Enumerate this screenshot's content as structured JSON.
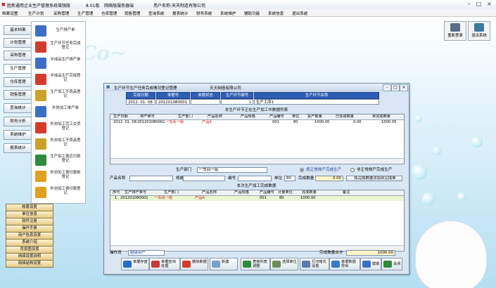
{
  "app": {
    "title": "胜新通用企业生产管理系统增强版",
    "version": "8.01版",
    "network": "网络版服务器端",
    "user": "用户名称:天天制造有限公司"
  },
  "menu": [
    "档案设置",
    "生产计划",
    "采购管理",
    "生产管理",
    "仓库管理",
    "销售管理",
    "查询系统",
    "报表统计",
    "财务系统",
    "系统维护",
    "辅助功能",
    "系统信息",
    "退出系统"
  ],
  "top_right_buttons": [
    {
      "label": "重新登录",
      "icon": "user-login-icon"
    },
    {
      "label": "退出系统",
      "icon": "exit-icon"
    }
  ],
  "left_tabs": [
    "基本档案",
    "计划管理",
    "采购管理",
    "生产管理",
    "仓库管理",
    "销售管理",
    "查询统计",
    "财务分析",
    "系统维护",
    "报表统计"
  ],
  "active_tab": "生产管理",
  "modules": [
    {
      "label": "生产排产单",
      "icon": "schedule-icon",
      "color": "#3b6fc4"
    },
    {
      "label": "生产环节任务完成登记",
      "icon": "arrow-up-icon",
      "color": "#d23c2a"
    },
    {
      "label": "半成品生产排产单",
      "icon": "schedule-icon",
      "color": "#3b6fc4"
    },
    {
      "label": "半成品生产完成登记",
      "icon": "arrow-up-icon",
      "color": "#d23c2a"
    },
    {
      "label": "生产加工不良品登记",
      "icon": "warning-icon",
      "color": "#c9a227"
    },
    {
      "label": "外协加工排产单",
      "icon": "schedule-icon",
      "color": "#3b6fc4"
    },
    {
      "label": "外协加工完工交货登记",
      "icon": "arrow-up-icon",
      "color": "#d23c2a"
    },
    {
      "label": "外协加工不良品登记",
      "icon": "warning-icon",
      "color": "#c9a227"
    },
    {
      "label": "生产加工费应付款登记",
      "icon": "calculator-icon",
      "color": "#2f8a3c"
    },
    {
      "label": "外协加工费付款帐登记",
      "icon": "ledger-icon",
      "color": "#e0a020"
    },
    {
      "label": "外协加工费付款登记",
      "icon": "ledger-icon",
      "color": "#e0a020"
    }
  ],
  "bottom_list": [
    "帐套设置",
    "单位信息",
    "软件注册",
    "操作手册",
    "用户信息设置",
    "系统介绍",
    "背景图设置",
    "网络设置说明",
    "网络结构设置"
  ],
  "dialog": {
    "title": "生产环节生产任务完成情况登记管理",
    "company": "天天制造有限公司",
    "header_labels": [
      "完成日期",
      "单据号",
      "单据状态",
      "生产环节编号",
      "生产环节名称"
    ],
    "header_values": [
      "2012- 01- 08",
      "201201080001",
      "",
      "1",
      "生产工序1"
    ],
    "section1_title": "本生产环节正在生产加工中数据列表",
    "grid1_columns": [
      "生产日期",
      "排产单号",
      "生产部门",
      "产品名称",
      "产品规格",
      "产品编号",
      "单位",
      "投产数量",
      "已完成数量",
      "未完成数量"
    ],
    "grid1_rows": [
      [
        "2012. 01. 08",
        "201201080001",
        "一车间一组",
        "产品A",
        "",
        "001",
        "80",
        "1000.00",
        "0.00",
        "1000.00"
      ]
    ],
    "dept_label": "生产部门",
    "dept_value": "一车间一组",
    "radio1_label": "按正常排产完成生产",
    "radio2_label": "非正常排产完成生产",
    "radio_selected": 1,
    "product_label": "产品名称",
    "spec_label": "规格",
    "code_label": "编号",
    "unit_label": "单位",
    "unit_value": "80",
    "qty_label": "完成数量",
    "qty_value": "0.00",
    "add_button": "将完成数据添加到完成单",
    "section2_title": "本次生产加工完成数据",
    "grid2_columns": [
      "序号",
      "生产排产单号",
      "生产部门",
      "产品名称",
      "产品规格",
      "产品编号",
      "计量单位",
      "完成数量",
      "备注"
    ],
    "grid2_rows": [
      [
        "1",
        "201201080001",
        "一车间一组",
        "产品A",
        "",
        "001",
        "80",
        "1000.00",
        ""
      ]
    ],
    "operator_label": "操作员",
    "operator_value": "超级用户",
    "total_label": "完成数量合计",
    "total_value": "1000.00",
    "toolbar": [
      {
        "label": "单据存盘",
        "icon": "save-icon",
        "color": "#2a6bc8"
      },
      {
        "label": "单据查询 处理",
        "icon": "query-icon",
        "color": "#c83a3a"
      },
      {
        "label": "删除数据",
        "icon": "delete-icon",
        "color": "#d23c2a"
      },
      {
        "label": "新建",
        "icon": "new-icon",
        "color": "#7aa0c8"
      },
      {
        "label": "表格列宽调整",
        "icon": "columns-icon",
        "color": "#2f8a3c"
      },
      {
        "label": "选择单位",
        "icon": "select-icon",
        "color": "#6f8f5a"
      },
      {
        "label": "打印格式设置",
        "icon": "print-icon",
        "color": "#5a7aa8"
      },
      {
        "label": "单据数据导出",
        "icon": "export-icon",
        "color": "#3a7ac8"
      },
      {
        "label": "帮助",
        "icon": "help-icon",
        "color": "#3b6fc4"
      },
      {
        "label": "关闭",
        "icon": "close-icon",
        "color": "#2f8a3c"
      }
    ]
  }
}
